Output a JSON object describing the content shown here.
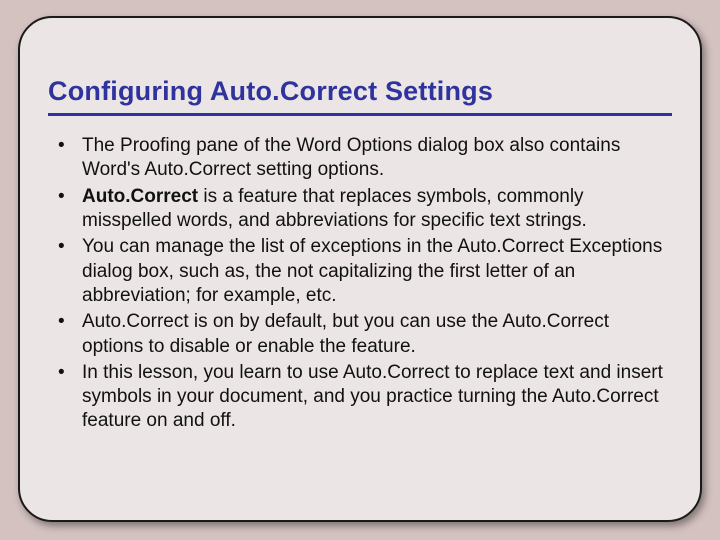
{
  "title": "Configuring Auto.Correct Settings",
  "bullets": [
    {
      "pre": "The Proofing pane of the Word Options dialog box also contains Word's Auto.Correct setting options.",
      "bold": "",
      "post": ""
    },
    {
      "pre": "",
      "bold": "Auto.Correct",
      "post": " is a feature that replaces symbols, commonly misspelled words, and abbreviations for specific text strings."
    },
    {
      "pre": "You can manage the list of exceptions in the Auto.Correct Exceptions dialog box, such as, the not capitalizing the first letter of an abbreviation; for example, etc.",
      "bold": "",
      "post": ""
    },
    {
      "pre": "Auto.Correct is on by default, but you can use the Auto.Correct options to disable or enable the feature.",
      "bold": "",
      "post": ""
    },
    {
      "pre": "In this lesson, you learn to use Auto.Correct to replace text and insert symbols in your document, and you practice turning the Auto.Correct feature on and off.",
      "bold": "",
      "post": ""
    }
  ]
}
